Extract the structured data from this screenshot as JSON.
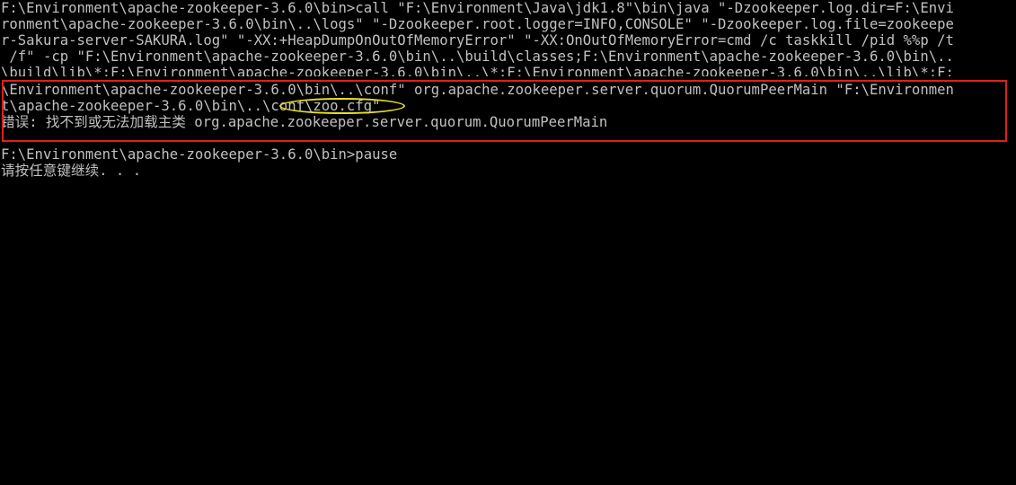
{
  "console": {
    "lines": [
      "F:\\Environment\\apache-zookeeper-3.6.0\\bin>call \"F:\\Environment\\Java\\jdk1.8\"\\bin\\java \"-Dzookeeper.log.dir=F:\\Envi",
      "ronment\\apache-zookeeper-3.6.0\\bin\\..\\logs\" \"-Dzookeeper.root.logger=INFO,CONSOLE\" \"-Dzookeeper.log.file=zookeepe",
      "r-Sakura-server-SAKURA.log\" \"-XX:+HeapDumpOnOutOfMemoryError\" \"-XX:OnOutOfMemoryError=cmd /c taskkill /pid %%p /t",
      " /f\" -cp \"F:\\Environment\\apache-zookeeper-3.6.0\\bin\\..\\build\\classes;F:\\Environment\\apache-zookeeper-3.6.0\\bin\\..",
      "\\build\\lib\\*;F:\\Environment\\apache-zookeeper-3.6.0\\bin\\..\\*;F:\\Environment\\apache-zookeeper-3.6.0\\bin\\..\\lib\\*;F:",
      "\\Environment\\apache-zookeeper-3.6.0\\bin\\..\\conf\" org.apache.zookeeper.server.quorum.QuorumPeerMain \"F:\\Environmen",
      "t\\apache-zookeeper-3.6.0\\bin\\..\\conf\\zoo.cfg\"",
      "错误: 找不到或无法加载主类 org.apache.zookeeper.server.quorum.QuorumPeerMain",
      "",
      "F:\\Environment\\apache-zookeeper-3.6.0\\bin>pause",
      "请按任意键继续. . ."
    ]
  },
  "annotations": {
    "box_color": "#e01e1e",
    "oval_color": "#e8e020"
  },
  "colors": {
    "background": "#000000",
    "text": "#c0c0c0"
  }
}
